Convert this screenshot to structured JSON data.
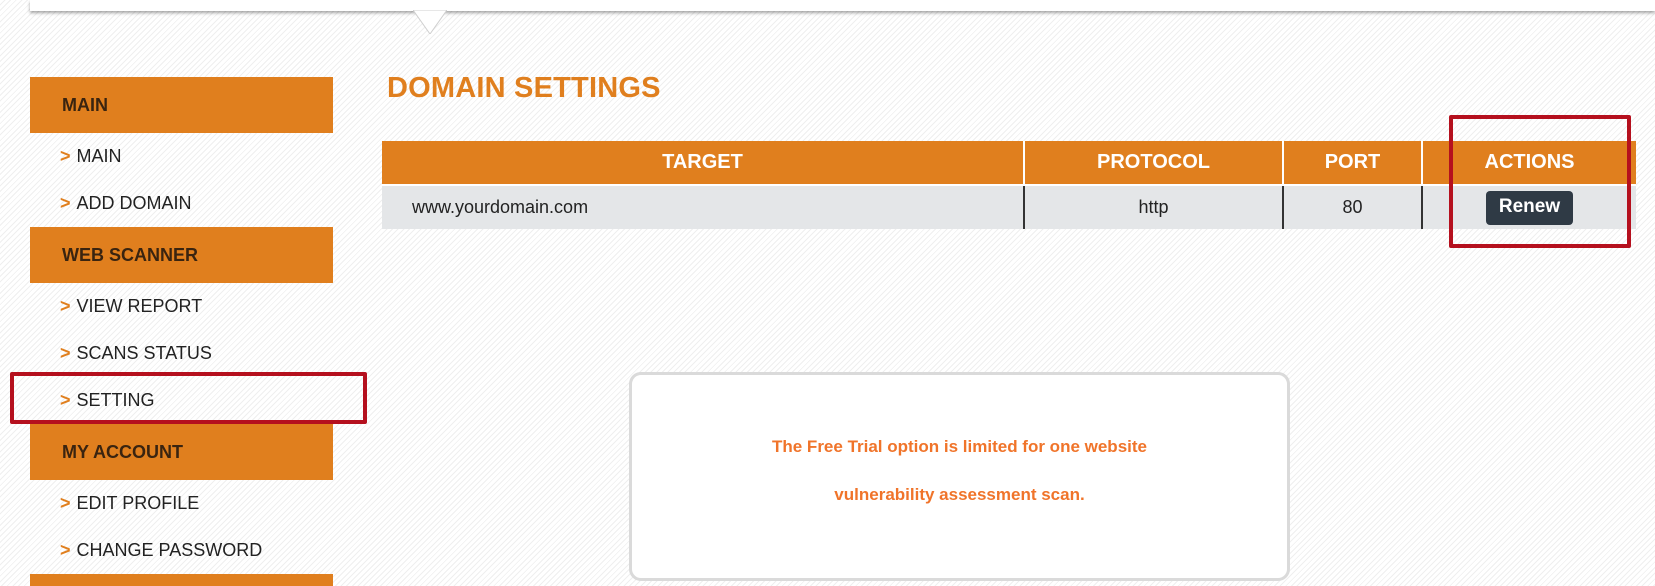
{
  "sidebar": {
    "sections": [
      {
        "header": "MAIN",
        "items": [
          "MAIN",
          "ADD DOMAIN"
        ]
      },
      {
        "header": "WEB SCANNER",
        "items": [
          "VIEW REPORT",
          "SCANS STATUS",
          "SETTING"
        ]
      },
      {
        "header": "MY ACCOUNT",
        "items": [
          "EDIT PROFILE",
          "CHANGE PASSWORD"
        ]
      }
    ],
    "chevron": ">"
  },
  "main": {
    "title": "DOMAIN SETTINGS",
    "table": {
      "headers": [
        "TARGET",
        "PROTOCOL",
        "PORT",
        "ACTIONS"
      ],
      "rows": [
        {
          "target": "www.yourdomain.com",
          "protocol": "http",
          "port": "80",
          "action": "Renew"
        }
      ]
    },
    "notice": {
      "line1": "The Free Trial option is limited for one website",
      "line2": "vulnerability assessment scan."
    }
  },
  "colors": {
    "accent": "#e07f1e",
    "highlight": "#b5101e",
    "button": "#2f3a45",
    "notice_text": "#f0742a"
  }
}
